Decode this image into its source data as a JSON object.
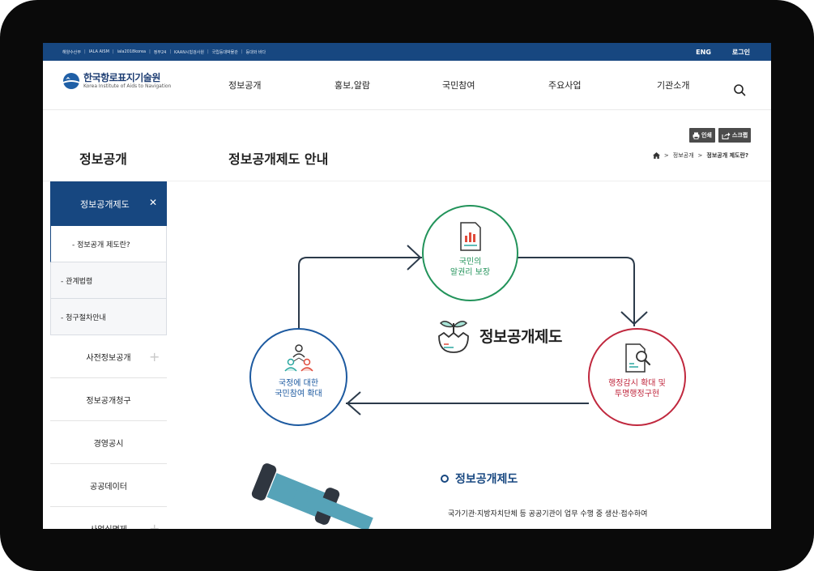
{
  "topbar": {
    "links": [
      "해양수산부",
      "IALA AISM",
      "iala2018korea",
      "정부24",
      "KAAN시험검사원",
      "국립등대박물관",
      "등대와 바다"
    ],
    "lang": "ENG",
    "login": "로그인"
  },
  "logo": {
    "name_ko": "한국항로표지기술원",
    "name_en": "Korea Institute of Aids to Navigation"
  },
  "gnb": [
    "정보공개",
    "홍보,알람",
    "국민참여",
    "주요사업",
    "기관소개"
  ],
  "section_title": "정보공개",
  "page_title": "정보공개제도 안내",
  "tools": {
    "print": "인쇄",
    "scrap": "스크랩"
  },
  "breadcrumb": [
    "정보공개",
    "정보공개 제도란?"
  ],
  "lnb": {
    "active": "정보공개제도",
    "active_close": "✕",
    "subs": [
      "- 정보공개 제도란?",
      "- 관계법령",
      "- 청구절차안내"
    ],
    "items": [
      {
        "label": "사전정보공개",
        "plus": "+"
      },
      {
        "label": "정보공개청구",
        "plus": ""
      },
      {
        "label": "경영공시",
        "plus": ""
      },
      {
        "label": "공공데이터",
        "plus": ""
      },
      {
        "label": "사업실명제",
        "plus": "+"
      }
    ]
  },
  "diagram": {
    "center": "정보공개제도",
    "top": {
      "line1": "국민의",
      "line2": "알권리 보장",
      "color": "#22935a"
    },
    "left": {
      "line1": "국정에 대한",
      "line2": "국민참여 확대",
      "color": "#1d5aa0"
    },
    "right": {
      "line1": "행정감시 확대 및",
      "line2": "투명행정구현",
      "color": "#c0283e"
    }
  },
  "content": {
    "heading": "정보공개제도",
    "paragraph": "국가기관·지방자치단체 등 공공기관이 업무 수행 중 생산·접수하여"
  },
  "colors": {
    "primary": "#174780",
    "accent_green": "#22935a",
    "accent_blue": "#1d5aa0",
    "accent_red": "#c0283e"
  }
}
